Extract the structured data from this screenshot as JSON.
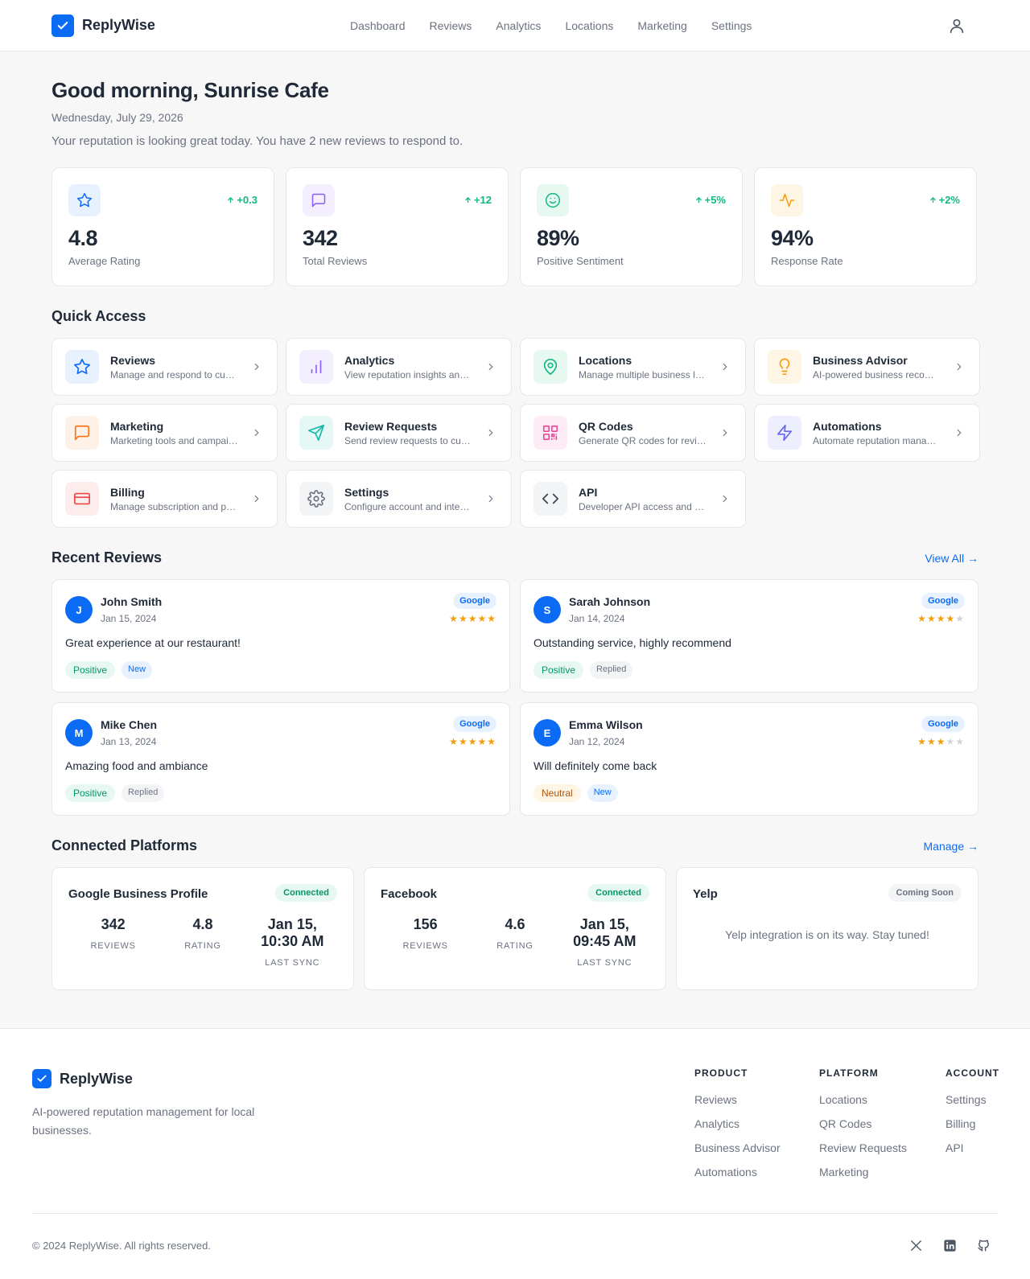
{
  "app": {
    "name": "ReplyWise"
  },
  "nav": [
    "Dashboard",
    "Reviews",
    "Analytics",
    "Locations",
    "Marketing",
    "Settings"
  ],
  "welcome": {
    "greeting": "Good morning, Sunrise Cafe",
    "date": "Wednesday, July 29, 2026",
    "message": "Your reputation is looking great today. You have 2 new reviews to respond to."
  },
  "stats": [
    {
      "value": "4.8",
      "label": "Average Rating",
      "change": "+0.3",
      "icon": "star-icon",
      "color": "#0b6bf4",
      "bg": "#e8f1fe"
    },
    {
      "value": "342",
      "label": "Total Reviews",
      "change": "+12",
      "icon": "message-icon",
      "color": "#8b5cf6",
      "bg": "#f3effe"
    },
    {
      "value": "89%",
      "label": "Positive Sentiment",
      "change": "+5%",
      "icon": "smile-icon",
      "color": "#10b981",
      "bg": "#e7f8f0"
    },
    {
      "value": "94%",
      "label": "Response Rate",
      "change": "+2%",
      "icon": "activity-icon",
      "color": "#f59e0b",
      "bg": "#fef5e4"
    }
  ],
  "quick_access": {
    "title": "Quick Access",
    "items": [
      {
        "title": "Reviews",
        "desc": "Manage and respond to customer reviews",
        "icon": "star-icon",
        "color": "#0b6bf4",
        "bg": "#e8f1fe"
      },
      {
        "title": "Analytics",
        "desc": "View reputation insights and trends",
        "icon": "bar-chart-icon",
        "color": "#8b5cf6",
        "bg": "#f3effe"
      },
      {
        "title": "Locations",
        "desc": "Manage multiple business locations",
        "icon": "map-pin-icon",
        "color": "#10b981",
        "bg": "#e7f8f0"
      },
      {
        "title": "Business Advisor",
        "desc": "AI-powered business recommendations",
        "icon": "lightbulb-icon",
        "color": "#f59e0b",
        "bg": "#fef5e4"
      },
      {
        "title": "Marketing",
        "desc": "Marketing tools and campaigns",
        "icon": "message-icon",
        "color": "#f97316",
        "bg": "#fef1e7"
      },
      {
        "title": "Review Requests",
        "desc": "Send review requests to customers",
        "icon": "send-icon",
        "color": "#14b8a6",
        "bg": "#e6f8f6"
      },
      {
        "title": "QR Codes",
        "desc": "Generate QR codes for reviews",
        "icon": "qr-code-icon",
        "color": "#ec4899",
        "bg": "#fdecf5"
      },
      {
        "title": "Automations",
        "desc": "Automate reputation management",
        "icon": "zap-icon",
        "color": "#6366f1",
        "bg": "#eeeffe"
      },
      {
        "title": "Billing",
        "desc": "Manage subscription and payments",
        "icon": "credit-card-icon",
        "color": "#ef4444",
        "bg": "#fdecec"
      },
      {
        "title": "Settings",
        "desc": "Configure account and integrations",
        "icon": "gear-icon",
        "color": "#6b7280",
        "bg": "#f3f4f6"
      },
      {
        "title": "API",
        "desc": "Developer API access and documentation",
        "icon": "code-icon",
        "color": "#374151",
        "bg": "#f3f4f6"
      }
    ]
  },
  "recent_reviews": {
    "title": "Recent Reviews",
    "link": "View All →",
    "items": [
      {
        "initial": "J",
        "name": "John Smith",
        "date": "Jan 15, 2024",
        "platform": "Google",
        "rating": 5,
        "text": "Great experience at our restaurant!",
        "sentiment": "Positive",
        "status": "New"
      },
      {
        "initial": "S",
        "name": "Sarah Johnson",
        "date": "Jan 14, 2024",
        "platform": "Google",
        "rating": 4,
        "text": "Outstanding service, highly recommend",
        "sentiment": "Positive",
        "status": "Replied"
      },
      {
        "initial": "M",
        "name": "Mike Chen",
        "date": "Jan 13, 2024",
        "platform": "Google",
        "rating": 5,
        "text": "Amazing food and ambiance",
        "sentiment": "Positive",
        "status": "Replied"
      },
      {
        "initial": "E",
        "name": "Emma Wilson",
        "date": "Jan 12, 2024",
        "platform": "Google",
        "rating": 3,
        "text": "Will definitely come back",
        "sentiment": "Neutral",
        "status": "New"
      }
    ]
  },
  "platforms": {
    "title": "Connected Platforms",
    "link": "Manage →",
    "items": [
      {
        "name": "Google Business Profile",
        "status": "Connected",
        "reviews": "342",
        "rating": "4.8",
        "last_sync": "Jan 15, 10:30 AM",
        "labels": [
          "REVIEWS",
          "RATING",
          "LAST SYNC"
        ]
      },
      {
        "name": "Facebook",
        "status": "Connected",
        "reviews": "156",
        "rating": "4.6",
        "last_sync": "Jan 15, 09:45 AM",
        "labels": [
          "REVIEWS",
          "RATING",
          "LAST SYNC"
        ]
      },
      {
        "name": "Yelp",
        "status": "Coming Soon",
        "message": "Yelp integration is on its way. Stay tuned!"
      }
    ]
  },
  "footer": {
    "brand": "ReplyWise",
    "description": "AI-powered reputation management for local businesses.",
    "columns": [
      {
        "title": "PRODUCT",
        "links": [
          "Reviews",
          "Analytics",
          "Business Advisor",
          "Automations"
        ]
      },
      {
        "title": "PLATFORM",
        "links": [
          "Locations",
          "QR Codes",
          "Review Requests",
          "Marketing"
        ]
      },
      {
        "title": "ACCOUNT",
        "links": [
          "Settings",
          "Billing",
          "API"
        ]
      }
    ],
    "copyright": "© 2024 ReplyWise. All rights reserved.",
    "social": [
      "x-icon",
      "linkedin-icon",
      "github-icon"
    ]
  }
}
